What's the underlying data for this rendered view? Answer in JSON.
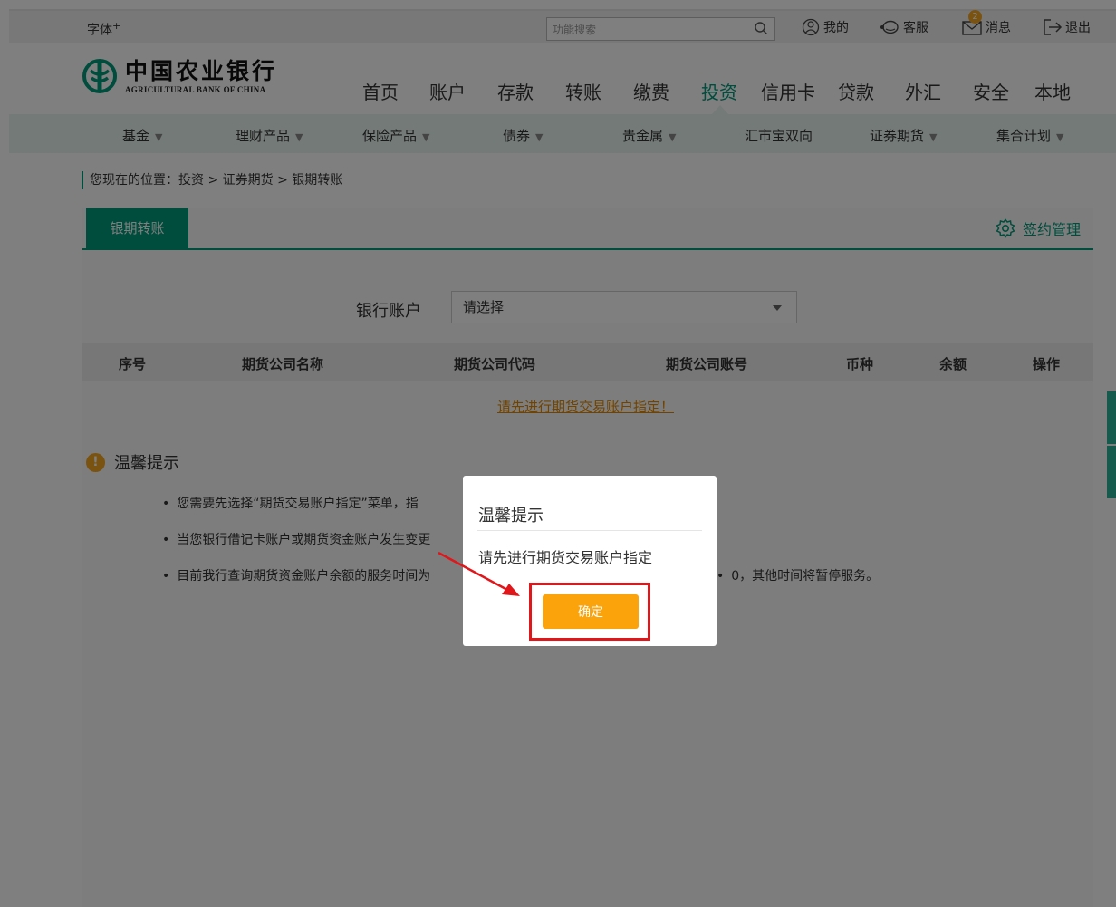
{
  "topbar": {
    "font_size_label": "字体",
    "font_size_sup": "+",
    "search_placeholder": "功能搜索",
    "mine_label": "我的",
    "service_label": "客服",
    "messages_label": "消息",
    "messages_badge": "2",
    "logout_label": "退出"
  },
  "header": {
    "logo_cn": "中国农业银行",
    "logo_en": "AGRICULTURAL BANK OF CHINA",
    "nav": [
      "首页",
      "账户",
      "存款",
      "转账",
      "缴费",
      "投资",
      "信用卡",
      "贷款",
      "外汇",
      "安全",
      "本地"
    ],
    "active_nav": "投资"
  },
  "subnav": {
    "items": [
      "基金",
      "理财产品",
      "保险产品",
      "债券",
      "贵金属",
      "汇市宝双向",
      "证券期货",
      "集合计划"
    ]
  },
  "breadcrumb": "您现在的位置：投资 > 证券期货 > 银期转账",
  "content": {
    "tab_label": "银期转账",
    "sign_mgmt_label": "签约管理",
    "account_label": "银行账户",
    "account_select_value": "请选择",
    "table_headers": [
      "序号",
      "期货公司名称",
      "期货公司代码",
      "期货公司账号",
      "币种",
      "余额",
      "操作"
    ],
    "empty_link": "请先进行期货交易账户指定！",
    "tips_title": "温馨提示",
    "tips": [
      "您需要先选择“期货交易账户指定”菜单，指",
      "当您银行借记卡账户或期货资金账户发生变更",
      "目前我行查询期货资金账户余额的服务时间为"
    ],
    "tip3_tail": "0，其他时间将暂停服务。"
  },
  "dialog": {
    "title": "温馨提示",
    "message": "请先进行期货交易账户指定",
    "confirm_label": "确定"
  },
  "colors": {
    "brand": "#009a7a",
    "subnav_bg": "#e7f5f1",
    "confirm": "#fba30a",
    "highlight": "#e0161a",
    "link": "#e08600"
  }
}
